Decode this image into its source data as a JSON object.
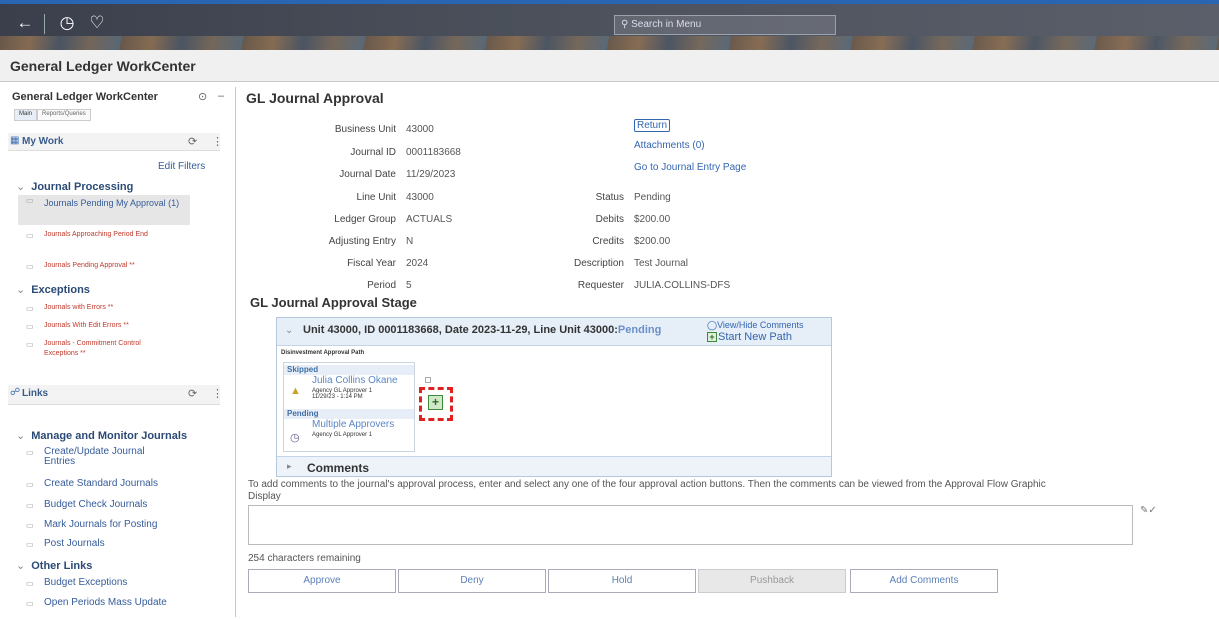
{
  "topbar": {
    "back_icon": "arrow-left-icon",
    "history_icon": "clock-icon",
    "favorites_icon": "heart-icon",
    "search_placeholder": "Search in Menu"
  },
  "page": {
    "title": "General Ledger WorkCenter"
  },
  "left": {
    "title": "General Ledger WorkCenter",
    "tabs": [
      "Main",
      "Reports/Queries"
    ],
    "my_work": {
      "label": "My Work",
      "edit_filters": "Edit Filters",
      "journal_processing": "Journal Processing",
      "items": [
        "Journals Pending My Approval (1)",
        "Journals Approaching Period End",
        "Journals Pending Approval **"
      ],
      "exceptions": "Exceptions",
      "exception_items": [
        "Journals with Errors **",
        "Journals With Edit Errors **",
        "Journals - Commitment Control Exceptions **"
      ]
    },
    "links": {
      "label": "Links",
      "manage": "Manage and Monitor Journals",
      "manage_items": [
        "Create/Update Journal Entries",
        "Create Standard Journals",
        "Budget Check Journals",
        "Mark Journals for Posting",
        "Post Journals"
      ],
      "other": "Other Links",
      "other_items": [
        "Budget Exceptions",
        "Open Periods Mass Update"
      ]
    }
  },
  "main": {
    "title": "GL Journal Approval",
    "fields_left": [
      {
        "label": "Business Unit",
        "value": "43000"
      },
      {
        "label": "Journal ID",
        "value": "0001183668"
      },
      {
        "label": "Journal Date",
        "value": "11/29/2023"
      },
      {
        "label": "Line Unit",
        "value": "43000"
      },
      {
        "label": "Ledger Group",
        "value": "ACTUALS"
      },
      {
        "label": "Adjusting Entry",
        "value": "N"
      },
      {
        "label": "Fiscal Year",
        "value": "2024"
      },
      {
        "label": "Period",
        "value": "5"
      }
    ],
    "fields_right": [
      {
        "label": "Status",
        "value": "Pending"
      },
      {
        "label": "Debits",
        "value": "$200.00"
      },
      {
        "label": "Credits",
        "value": "$200.00"
      },
      {
        "label": "Description",
        "value": "Test Journal"
      },
      {
        "label": "Requester",
        "value": "JULIA.COLLINS-DFS"
      }
    ],
    "links": {
      "return": "Return",
      "attachments": "Attachments (0)",
      "goto": "Go to Journal Entry Page"
    },
    "stage_title": "GL Journal Approval Stage",
    "stage": {
      "header": "Unit 43000, ID 0001183668, Date 2023-11-29, Line Unit 43000:",
      "status": "Pending",
      "view_hide": "View/Hide Comments",
      "start_new_path": "Start New Path",
      "path_title": "Disinvestment Approval Path",
      "steps": [
        {
          "state": "Skipped",
          "name": "Julia Collins Okane",
          "role": "Agency GL Approver 1",
          "time": "11/29/23 - 1:14 PM"
        },
        {
          "state": "Pending",
          "name": "Multiple Approvers",
          "role": "Agency GL Approver 1"
        }
      ],
      "comments_label": "Comments"
    },
    "instructions": "To add comments to the journal's approval process, enter and select any one of the four approval action buttons. Then the comments can be viewed from the Approval Flow Graphic Display",
    "remaining": "254 characters remaining",
    "buttons": [
      "Approve",
      "Deny",
      "Hold",
      "Pushback",
      "Add Comments"
    ]
  }
}
